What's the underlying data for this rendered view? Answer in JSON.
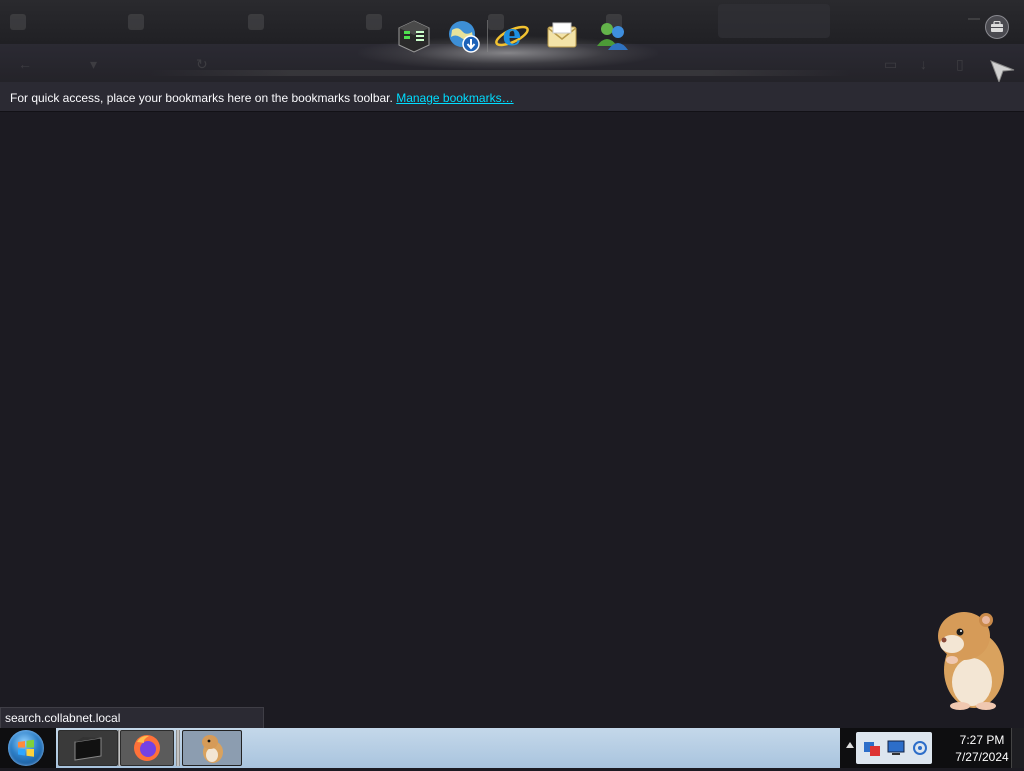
{
  "browser": {
    "tabs": [
      "",
      "",
      "",
      "",
      "",
      ""
    ],
    "bookmarks_bar": {
      "message": "For quick access, place your bookmarks here on the bookmarks toolbar.",
      "manage_link": "Manage bookmarks…"
    },
    "status_url": "search.collabnet.local"
  },
  "dock": {
    "items": [
      "app-cube-icon",
      "globe-download-icon",
      "internet-explorer-icon",
      "mail-envelope-icon",
      "messenger-people-icon"
    ]
  },
  "taskbar": {
    "buttons": [
      "terminal",
      "firefox",
      "hamster"
    ],
    "clock": {
      "time": "7:27 PM",
      "date": "7/27/2024"
    }
  },
  "colors": {
    "content_bg": "#1c1b22",
    "toolbar_bg": "#2b2a33",
    "link": "#00ddff",
    "taskbar": "#b4cce4"
  }
}
